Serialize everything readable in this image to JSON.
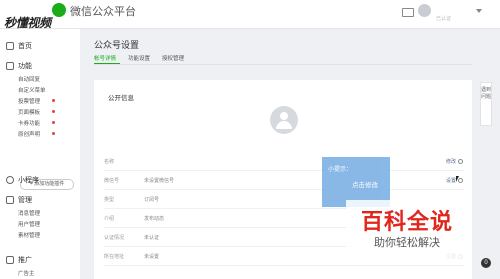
{
  "header": {
    "app_title": "微信公众平台",
    "watermark": "秒懂视频",
    "user_name": "",
    "user_sub": "已认证"
  },
  "sidebar": {
    "home": "首页",
    "function_group": "功能",
    "function_items": [
      {
        "label": "自动回复",
        "dot": false
      },
      {
        "label": "自定义菜单",
        "dot": false
      },
      {
        "label": "投票管理",
        "dot": true
      },
      {
        "label": "页面模板",
        "dot": true
      },
      {
        "label": "卡券功能",
        "dot": true
      },
      {
        "label": "原创声明",
        "dot": true
      }
    ],
    "add_button": "+ 添加功能插件",
    "miniprogram": "小程序",
    "manage_group": "管理",
    "manage_items": [
      "消息管理",
      "用户管理",
      "素材管理"
    ],
    "promote_group": "推广",
    "promote_items": [
      "广告主"
    ]
  },
  "main": {
    "page_title": "公众号设置",
    "tabs": [
      "帐号详情",
      "功能设置",
      "授权管理"
    ],
    "active_tab": 0,
    "card_title": "公开信息",
    "rows": [
      {
        "label": "名称",
        "value": "",
        "action": "修改"
      },
      {
        "label": "微信号",
        "value": "未设置微信号",
        "action": "设置"
      },
      {
        "label": "类型",
        "value": "订阅号",
        "action": ""
      },
      {
        "label": "介绍",
        "value": "发布动态",
        "action": ""
      },
      {
        "label": "认证情况",
        "value": "未认证",
        "action": ""
      },
      {
        "label": "所在地址",
        "value": "未设置",
        "action": "设置"
      }
    ]
  },
  "tooltip": {
    "title": "小提示：",
    "text": "点击修改"
  },
  "overlay_watermark": {
    "big": "百科全说",
    "small": "助你轻松解决"
  },
  "feedback_label": "遇到问题",
  "badge_count": "0",
  "colors": {
    "accent": "#1aad19",
    "tooltip": "#7fb3e6",
    "watermark_red": "#e1261c",
    "red_dot": "#e64340"
  }
}
